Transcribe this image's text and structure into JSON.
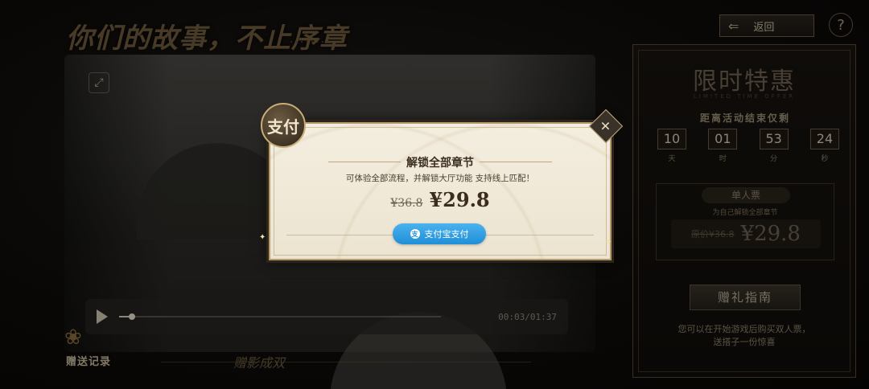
{
  "background": {
    "title_art": "你们的故事，不止序章",
    "title_dots": "·······",
    "video": {
      "time_readout": "00:03/01:37",
      "progress": 0.04
    },
    "gift_record_label": "赠送记录",
    "bottom_tab": "赠影成双"
  },
  "header": {
    "back_label": "返回",
    "help_label": "?"
  },
  "promo": {
    "title": "限时特惠",
    "subtitle": "LIMITED TIME OFFER",
    "countdown_label": "距离活动结束仅剩",
    "countdown": [
      {
        "value": "10",
        "unit": "天"
      },
      {
        "value": "01",
        "unit": "时"
      },
      {
        "value": "53",
        "unit": "分"
      },
      {
        "value": "24",
        "unit": "秒"
      }
    ],
    "ticket": {
      "name": "单人票",
      "sub": "为自己解锁全部章节",
      "original_price": "原价¥36.8",
      "price": "¥29.8"
    },
    "gift_guide_label": "赠礼指南",
    "note_line1": "您可以在开始游戏后购买双人票，",
    "note_line2": "送搭子一份惊喜"
  },
  "modal": {
    "badge": "支付",
    "title": "解锁全部章节",
    "description": "可体验全部流程，并解锁大厅功能 支持线上匹配！",
    "original_price": "¥36.8",
    "price": "¥29.8",
    "pay_button_label": "支付宝支付",
    "pay_icon": "支",
    "close_label": "✕"
  },
  "colors": {
    "accent_gold": "#b49a6c",
    "alipay_blue": "#1f8fd8",
    "modal_bg": "#f4eee0"
  }
}
